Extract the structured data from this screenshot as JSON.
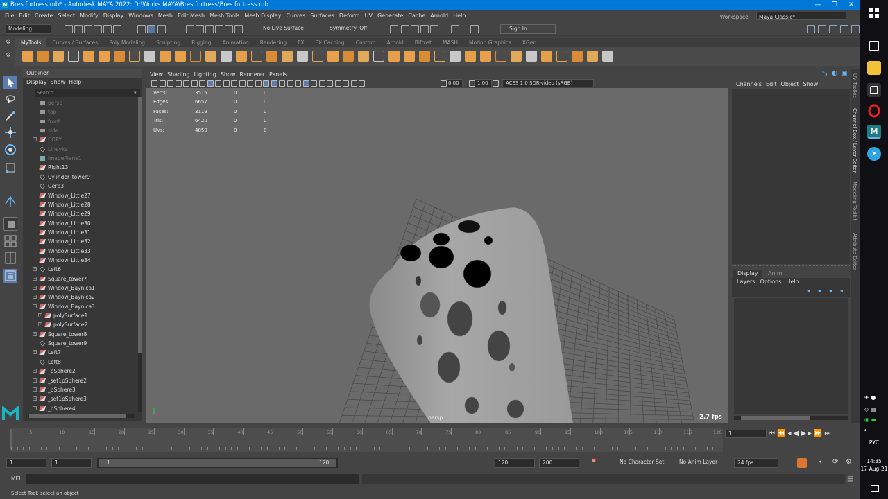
{
  "window": {
    "title": "Bres fortress.mb* - Autodesk MAYA 2022: D:\\Works MAYA\\Bres fortress\\Bres fortress.mb",
    "app_icon": "M",
    "controls": [
      "—",
      "❐",
      "✕"
    ]
  },
  "menubar": [
    "File",
    "Edit",
    "Create",
    "Select",
    "Modify",
    "Display",
    "Windows",
    "Mesh",
    "Edit Mesh",
    "Mesh Tools",
    "Mesh Display",
    "Curves",
    "Surfaces",
    "Deform",
    "UV",
    "Generate",
    "Cache",
    "Arnold",
    "Help"
  ],
  "workspace": {
    "label": "Workspace :",
    "value": "Maya Classic*"
  },
  "statusline": {
    "menuset": "Modeling",
    "live_surface": "No Live Surface",
    "symmetry": "Symmetry: Off",
    "sign_in": "Sign In"
  },
  "shelf": {
    "tabs": [
      "MyTools",
      "Curves / Surfaces",
      "Poly Modeling",
      "Sculpting",
      "Rigging",
      "Animation",
      "Rendering",
      "FX",
      "FX Caching",
      "Custom",
      "Arnold",
      "Bifrost",
      "MASH",
      "Motion Graphics",
      "XGen"
    ],
    "active_tab": "MyTools"
  },
  "outliner": {
    "title": "Outliner",
    "menu": [
      "Display",
      "Show",
      "Help"
    ],
    "search_placeholder": "Search...",
    "items": [
      {
        "label": "persp",
        "type": "camera",
        "dim": true,
        "expand": false,
        "indent": 0
      },
      {
        "label": "top",
        "type": "camera",
        "dim": true,
        "expand": false,
        "indent": 0
      },
      {
        "label": "front",
        "type": "camera",
        "dim": true,
        "expand": false,
        "indent": 0
      },
      {
        "label": "side",
        "type": "camera",
        "dim": true,
        "expand": false,
        "indent": 0
      },
      {
        "label": "COPY",
        "type": "mesh",
        "dim": true,
        "expand": true,
        "indent": 0
      },
      {
        "label": "Lineyka",
        "type": "group",
        "dim": true,
        "expand": false,
        "indent": 0
      },
      {
        "label": "imagePlane1",
        "type": "image",
        "dim": true,
        "expand": false,
        "indent": 0
      },
      {
        "label": "Right13",
        "type": "mesh",
        "dim": false,
        "expand": false,
        "indent": 0
      },
      {
        "label": "Cylinder_tower9",
        "type": "group",
        "dim": false,
        "expand": false,
        "indent": 0
      },
      {
        "label": "Gerb3",
        "type": "group",
        "dim": false,
        "expand": false,
        "indent": 0
      },
      {
        "label": "Window_Little27",
        "type": "mesh",
        "dim": false,
        "expand": false,
        "indent": 0
      },
      {
        "label": "Window_Little28",
        "type": "mesh",
        "dim": false,
        "expand": false,
        "indent": 0
      },
      {
        "label": "Window_Little29",
        "type": "mesh",
        "dim": false,
        "expand": false,
        "indent": 0
      },
      {
        "label": "Window_Little30",
        "type": "mesh",
        "dim": false,
        "expand": false,
        "indent": 0
      },
      {
        "label": "Window_Little31",
        "type": "mesh",
        "dim": false,
        "expand": false,
        "indent": 0
      },
      {
        "label": "Window_Little32",
        "type": "mesh",
        "dim": false,
        "expand": false,
        "indent": 0
      },
      {
        "label": "Window_Little33",
        "type": "mesh",
        "dim": false,
        "expand": false,
        "indent": 0
      },
      {
        "label": "Window_Little34",
        "type": "mesh",
        "dim": false,
        "expand": false,
        "indent": 0
      },
      {
        "label": "Left6",
        "type": "group",
        "dim": false,
        "expand": true,
        "indent": 0
      },
      {
        "label": "Square_tower7",
        "type": "mesh",
        "dim": false,
        "expand": true,
        "indent": 0
      },
      {
        "label": "Window_Baynica1",
        "type": "mesh",
        "dim": false,
        "expand": true,
        "indent": 0
      },
      {
        "label": "Window_Baynica2",
        "type": "mesh",
        "dim": false,
        "expand": true,
        "indent": 0
      },
      {
        "label": "Window_Baynica3",
        "type": "mesh",
        "dim": false,
        "expand": true,
        "indent": 0
      },
      {
        "label": "polySurface1",
        "type": "mesh",
        "dim": false,
        "expand": true,
        "indent": 1
      },
      {
        "label": "polySurface2",
        "type": "mesh",
        "dim": false,
        "expand": true,
        "indent": 1
      },
      {
        "label": "Square_tower8",
        "type": "mesh",
        "dim": false,
        "expand": true,
        "indent": 0
      },
      {
        "label": "Square_tower9",
        "type": "group",
        "dim": false,
        "expand": false,
        "indent": 0
      },
      {
        "label": "Left7",
        "type": "mesh",
        "dim": false,
        "expand": true,
        "indent": 0
      },
      {
        "label": "Left8",
        "type": "group",
        "dim": false,
        "expand": false,
        "indent": 0
      },
      {
        "label": "_pSphere2",
        "type": "mesh",
        "dim": false,
        "expand": true,
        "indent": 0
      },
      {
        "label": "_set1pSphere2",
        "type": "mesh",
        "dim": false,
        "expand": true,
        "indent": 0
      },
      {
        "label": "_pSphere3",
        "type": "mesh",
        "dim": false,
        "expand": true,
        "indent": 0
      },
      {
        "label": "_set1pSphere3",
        "type": "mesh",
        "dim": false,
        "expand": true,
        "indent": 0
      },
      {
        "label": "_pSphere4",
        "type": "mesh",
        "dim": false,
        "expand": true,
        "indent": 0
      }
    ]
  },
  "viewport": {
    "menu": [
      "View",
      "Shading",
      "Lighting",
      "Show",
      "Renderer",
      "Panels"
    ],
    "exposure": "0.00",
    "gamma": "1.00",
    "colorspace": "ACES 1.0 SDR-video (sRGB)",
    "camera": "persp",
    "fps": "2.7 fps",
    "hud": [
      {
        "label": "Verts:",
        "v1": "3515",
        "v2": "0",
        "v3": "0"
      },
      {
        "label": "Edges:",
        "v1": "6657",
        "v2": "0",
        "v3": "0"
      },
      {
        "label": "Faces:",
        "v1": "3119",
        "v2": "0",
        "v3": "0"
      },
      {
        "label": "Tris:",
        "v1": "6420",
        "v2": "0",
        "v3": "0"
      },
      {
        "label": "UVs:",
        "v1": "4850",
        "v2": "0",
        "v3": "0"
      }
    ]
  },
  "channelbox": {
    "menu": [
      "Channels",
      "Edit",
      "Object",
      "Show"
    ]
  },
  "layer_editor": {
    "tabs": [
      "Display",
      "Anim"
    ],
    "active_tab": "Display",
    "menu": [
      "Layers",
      "Options",
      "Help"
    ]
  },
  "side_tabs": [
    "UV Toolkit",
    "Channel Box / Layer Editor",
    "Modeling Toolkit",
    "Attribute Editor"
  ],
  "timeline": {
    "ticks": [
      5,
      10,
      15,
      20,
      25,
      30,
      35,
      40,
      45,
      50,
      55,
      60,
      65,
      70,
      75,
      80,
      85,
      90,
      95,
      100,
      105,
      110,
      115,
      120
    ],
    "min": 1,
    "max": 120,
    "current_frame": "1"
  },
  "range": {
    "start": "1",
    "playback_start": "1",
    "slider_start": "1",
    "slider_end": "120",
    "playback_end": "120",
    "end": "200",
    "character_set": "No Character Set",
    "anim_layer": "No Anim Layer",
    "fps": "24 fps"
  },
  "cmdline": {
    "lang": "MEL"
  },
  "helpline": "Select Tool: select an object",
  "os": {
    "lang": "РУС",
    "time": "14:35",
    "date": "17-Aug-21"
  }
}
